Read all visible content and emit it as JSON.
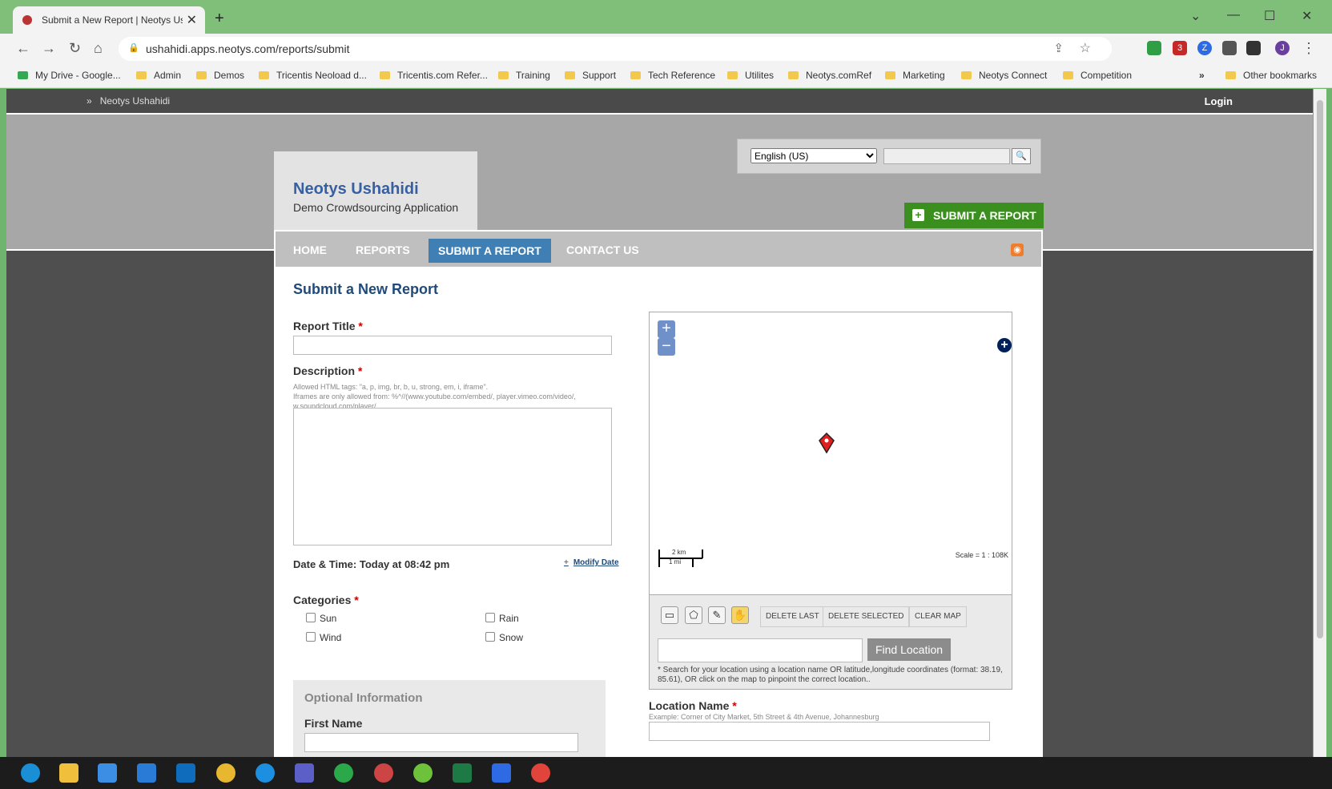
{
  "browser": {
    "tab_title": "Submit a New Report | Neotys Us",
    "tab_close": "✕",
    "new_tab": "+",
    "window_controls": [
      "⌄",
      "—",
      "☐",
      "✕"
    ],
    "nav": {
      "back": "←",
      "forward": "→",
      "reload": "↻",
      "home": "⌂"
    },
    "url": "ushahidi.apps.neotys.com/reports/submit",
    "menu_glyph": "⋮",
    "bookmarks": [
      "My Drive - Google...",
      "Admin",
      "Demos",
      "Tricentis Neoload d...",
      "Tricentis.com Refer...",
      "Training",
      "Support",
      "Tech Reference",
      "Utilites",
      "Neotys.comRef",
      "Marketing",
      "Neotys Connect",
      "Competition"
    ],
    "more_bookmarks": "»",
    "other_bookmarks": "Other bookmarks"
  },
  "site": {
    "breadcrumb": "Neotys Ushahidi",
    "breadcrumb_glyph": "»",
    "login": "Login",
    "logo_title": "Neotys Ushahidi",
    "logo_subtitle": "Demo Crowdsourcing Application",
    "language": "English (US)",
    "search_glyph": "🔍",
    "submit_button": "SUBMIT A REPORT",
    "submit_plus": "+",
    "menu": [
      "HOME",
      "REPORTS",
      "SUBMIT A REPORT",
      "CONTACT US"
    ],
    "rss_glyph": "◉"
  },
  "form": {
    "heading": "Submit a New Report",
    "report_title_label": "Report Title",
    "required_mark": "*",
    "description_label": "Description",
    "description_note": "Allowed HTML tags: \"a, p, img, br, b, u, strong, em, i, iframe\".",
    "description_note2": "Iframes are only allowed from: %^//(www.youtube.com/embed/, player.vimeo.com/video/, w.soundcloud.com/player/.",
    "datetime": "Date & Time: Today at 08:42 pm",
    "modify_date": "Modify Date",
    "modify_plus": "+",
    "categories_label": "Categories",
    "categories": [
      "Sun",
      "Wind",
      "Rain",
      "Snow"
    ],
    "optional_title": "Optional Information",
    "first_name_label": "First Name"
  },
  "map": {
    "zoom_in": "+",
    "zoom_out": "−",
    "layers": "+",
    "scale_km": "2 km",
    "scale_mi": "1 mi",
    "scale_text": "Scale = 1 : 108K",
    "tools": [
      "▭",
      "⬠",
      "✎",
      "✋"
    ],
    "delete_last": "DELETE LAST",
    "delete_selected": "DELETE SELECTED",
    "clear_map": "CLEAR MAP",
    "find_location": "Find Location",
    "location_hint": "* Search for your location using a location name OR latitude,longitude coordinates (format: 38.19, 85.61), OR click on the map to pinpoint the correct location..",
    "location_name_label": "Location Name",
    "location_example": "Example: Corner of City Market, 5th Street & 4th Avenue, Johannesburg"
  },
  "colors": {
    "accent": "#3f7fb3",
    "submit": "#3b8f1e",
    "title": "#3760a3",
    "pin": "#e02020"
  },
  "taskbar_icons": [
    "edge-icon",
    "file-explorer-icon",
    "store-icon",
    "mail-icon",
    "outlook-icon",
    "slack-icon",
    "skype-icon",
    "teams-icon",
    "evernote-icon",
    "neoload-icon",
    "app-icon",
    "excel-icon",
    "zoom-icon",
    "chrome-icon"
  ]
}
